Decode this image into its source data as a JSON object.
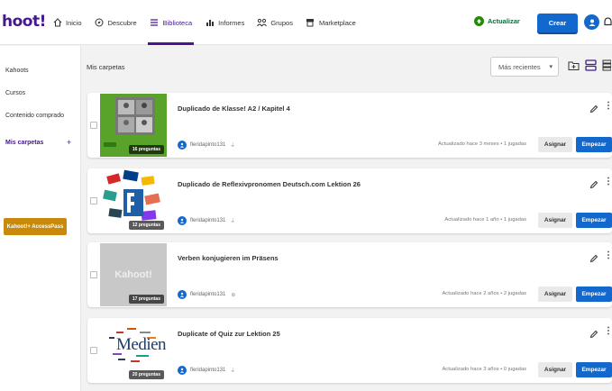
{
  "app": {
    "logo_text": "hoot!"
  },
  "nav": {
    "items": [
      {
        "label": "Inicio",
        "icon": "home-icon"
      },
      {
        "label": "Descubre",
        "icon": "compass-icon"
      },
      {
        "label": "Biblioteca",
        "icon": "list-icon",
        "active": true
      },
      {
        "label": "Informes",
        "icon": "bar-chart-icon"
      },
      {
        "label": "Grupos",
        "icon": "group-icon"
      },
      {
        "label": "Marketplace",
        "icon": "store-icon"
      }
    ]
  },
  "header": {
    "upgrade_label": "Actualizar",
    "create_label": "Crear"
  },
  "sidebar": {
    "items": [
      {
        "label": "Kahoots"
      },
      {
        "label": "Cursos"
      },
      {
        "label": "Contenido comprado"
      },
      {
        "label": "Mis carpetas",
        "active": true,
        "action": "+"
      }
    ],
    "access_button": "Kahoot!+ AccessPass"
  },
  "main": {
    "folder_title": "Mis carpetas",
    "sort": {
      "selected": "Más recientes",
      "caret": "▾"
    },
    "cards": [
      {
        "title": "Duplicado de Klasse! A2 / Kapitel 4",
        "questions": "16 preguntas",
        "owner": "fleridapinto131",
        "owner_extra": "⍊",
        "meta": "Actualizado hace 3 meses • 1 jugadas",
        "assign_label": "Asignar",
        "start_label": "Empezar"
      },
      {
        "title": "Duplicado de Reflexivpronomen Deutsch.com Lektion 26",
        "questions": "12 preguntas",
        "owner": "fleridapinto131",
        "owner_extra": "⍊",
        "meta": "Actualizado hace 1 año • 1 jugadas",
        "assign_label": "Asignar",
        "start_label": "Empezar"
      },
      {
        "title": "Verben konjugieren im Präsens",
        "questions": "17 preguntas",
        "owner": "fleridapinto131",
        "owner_extra": "⊕",
        "meta": "Actualizado hace 2 años • 2 jugadas",
        "assign_label": "Asignar",
        "start_label": "Empezar",
        "thumb_text": "Kahoot!"
      },
      {
        "title": "Duplicate of Quiz zur Lektion 25",
        "questions": "20 preguntas",
        "owner": "fleridapinto131",
        "owner_extra": "⍊",
        "meta": "Actualizado hace 3 años • 0 jugadas",
        "assign_label": "Asignar",
        "start_label": "Empezar",
        "thumb_text": "Medien"
      }
    ]
  },
  "colors": {
    "brand": "#46178f",
    "primary": "#1368ce",
    "success": "#26890c",
    "gold": "#c9890a"
  }
}
